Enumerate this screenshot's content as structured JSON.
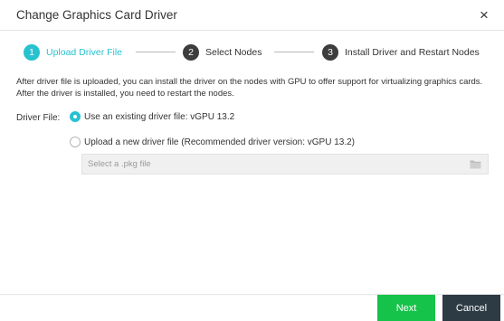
{
  "dialog": {
    "title": "Change Graphics Card Driver",
    "close_glyph": "×"
  },
  "steps": [
    {
      "number": "1",
      "label": "Upload Driver File",
      "active": true
    },
    {
      "number": "2",
      "label": "Select Nodes",
      "active": false
    },
    {
      "number": "3",
      "label": "Install Driver and Restart Nodes",
      "active": false
    }
  ],
  "description": "After driver file is uploaded, you can install the driver on the nodes with GPU to offer support for virtualizing graphics cards. After the driver is installed, you need to restart the nodes.",
  "driver_file": {
    "label": "Driver File:",
    "options": [
      {
        "label": "Use an existing driver file: vGPU 13.2",
        "selected": true
      },
      {
        "label": "Upload a new driver file (Recommended driver version: vGPU 13.2)",
        "selected": false
      }
    ],
    "file_input": {
      "placeholder": "Select a .pkg file",
      "value": ""
    }
  },
  "footer": {
    "next_label": "Next",
    "cancel_label": "Cancel"
  },
  "colors": {
    "accent": "#27c2d0",
    "next_button": "#16c34a",
    "cancel_button": "#2d3b44",
    "inactive_step": "#3d3d3d"
  },
  "icons": {
    "close": "close-icon",
    "folder": "folder-icon"
  }
}
